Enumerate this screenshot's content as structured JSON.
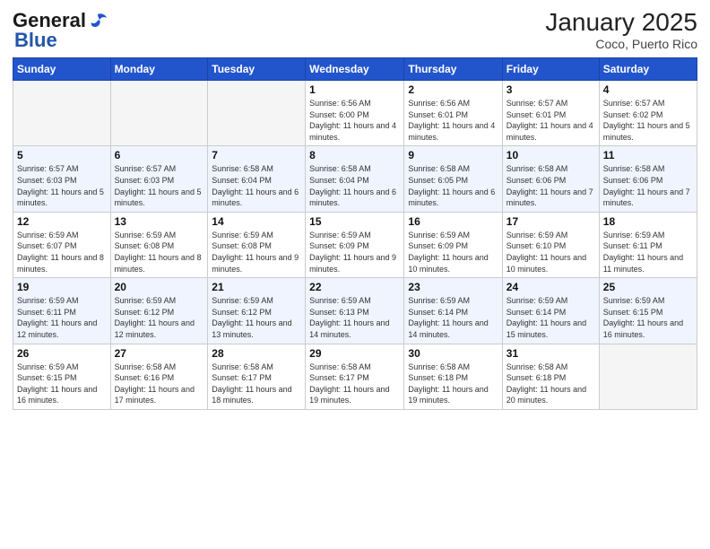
{
  "header": {
    "logo_general": "General",
    "logo_blue": "Blue",
    "month_year": "January 2025",
    "location": "Coco, Puerto Rico"
  },
  "weekdays": [
    "Sunday",
    "Monday",
    "Tuesday",
    "Wednesday",
    "Thursday",
    "Friday",
    "Saturday"
  ],
  "weeks": [
    [
      {
        "day": "",
        "info": ""
      },
      {
        "day": "",
        "info": ""
      },
      {
        "day": "",
        "info": ""
      },
      {
        "day": "1",
        "info": "Sunrise: 6:56 AM\nSunset: 6:00 PM\nDaylight: 11 hours and 4 minutes."
      },
      {
        "day": "2",
        "info": "Sunrise: 6:56 AM\nSunset: 6:01 PM\nDaylight: 11 hours and 4 minutes."
      },
      {
        "day": "3",
        "info": "Sunrise: 6:57 AM\nSunset: 6:01 PM\nDaylight: 11 hours and 4 minutes."
      },
      {
        "day": "4",
        "info": "Sunrise: 6:57 AM\nSunset: 6:02 PM\nDaylight: 11 hours and 5 minutes."
      }
    ],
    [
      {
        "day": "5",
        "info": "Sunrise: 6:57 AM\nSunset: 6:03 PM\nDaylight: 11 hours and 5 minutes."
      },
      {
        "day": "6",
        "info": "Sunrise: 6:57 AM\nSunset: 6:03 PM\nDaylight: 11 hours and 5 minutes."
      },
      {
        "day": "7",
        "info": "Sunrise: 6:58 AM\nSunset: 6:04 PM\nDaylight: 11 hours and 6 minutes."
      },
      {
        "day": "8",
        "info": "Sunrise: 6:58 AM\nSunset: 6:04 PM\nDaylight: 11 hours and 6 minutes."
      },
      {
        "day": "9",
        "info": "Sunrise: 6:58 AM\nSunset: 6:05 PM\nDaylight: 11 hours and 6 minutes."
      },
      {
        "day": "10",
        "info": "Sunrise: 6:58 AM\nSunset: 6:06 PM\nDaylight: 11 hours and 7 minutes."
      },
      {
        "day": "11",
        "info": "Sunrise: 6:58 AM\nSunset: 6:06 PM\nDaylight: 11 hours and 7 minutes."
      }
    ],
    [
      {
        "day": "12",
        "info": "Sunrise: 6:59 AM\nSunset: 6:07 PM\nDaylight: 11 hours and 8 minutes."
      },
      {
        "day": "13",
        "info": "Sunrise: 6:59 AM\nSunset: 6:08 PM\nDaylight: 11 hours and 8 minutes."
      },
      {
        "day": "14",
        "info": "Sunrise: 6:59 AM\nSunset: 6:08 PM\nDaylight: 11 hours and 9 minutes."
      },
      {
        "day": "15",
        "info": "Sunrise: 6:59 AM\nSunset: 6:09 PM\nDaylight: 11 hours and 9 minutes."
      },
      {
        "day": "16",
        "info": "Sunrise: 6:59 AM\nSunset: 6:09 PM\nDaylight: 11 hours and 10 minutes."
      },
      {
        "day": "17",
        "info": "Sunrise: 6:59 AM\nSunset: 6:10 PM\nDaylight: 11 hours and 10 minutes."
      },
      {
        "day": "18",
        "info": "Sunrise: 6:59 AM\nSunset: 6:11 PM\nDaylight: 11 hours and 11 minutes."
      }
    ],
    [
      {
        "day": "19",
        "info": "Sunrise: 6:59 AM\nSunset: 6:11 PM\nDaylight: 11 hours and 12 minutes."
      },
      {
        "day": "20",
        "info": "Sunrise: 6:59 AM\nSunset: 6:12 PM\nDaylight: 11 hours and 12 minutes."
      },
      {
        "day": "21",
        "info": "Sunrise: 6:59 AM\nSunset: 6:12 PM\nDaylight: 11 hours and 13 minutes."
      },
      {
        "day": "22",
        "info": "Sunrise: 6:59 AM\nSunset: 6:13 PM\nDaylight: 11 hours and 14 minutes."
      },
      {
        "day": "23",
        "info": "Sunrise: 6:59 AM\nSunset: 6:14 PM\nDaylight: 11 hours and 14 minutes."
      },
      {
        "day": "24",
        "info": "Sunrise: 6:59 AM\nSunset: 6:14 PM\nDaylight: 11 hours and 15 minutes."
      },
      {
        "day": "25",
        "info": "Sunrise: 6:59 AM\nSunset: 6:15 PM\nDaylight: 11 hours and 16 minutes."
      }
    ],
    [
      {
        "day": "26",
        "info": "Sunrise: 6:59 AM\nSunset: 6:15 PM\nDaylight: 11 hours and 16 minutes."
      },
      {
        "day": "27",
        "info": "Sunrise: 6:58 AM\nSunset: 6:16 PM\nDaylight: 11 hours and 17 minutes."
      },
      {
        "day": "28",
        "info": "Sunrise: 6:58 AM\nSunset: 6:17 PM\nDaylight: 11 hours and 18 minutes."
      },
      {
        "day": "29",
        "info": "Sunrise: 6:58 AM\nSunset: 6:17 PM\nDaylight: 11 hours and 19 minutes."
      },
      {
        "day": "30",
        "info": "Sunrise: 6:58 AM\nSunset: 6:18 PM\nDaylight: 11 hours and 19 minutes."
      },
      {
        "day": "31",
        "info": "Sunrise: 6:58 AM\nSunset: 6:18 PM\nDaylight: 11 hours and 20 minutes."
      },
      {
        "day": "",
        "info": ""
      }
    ]
  ]
}
